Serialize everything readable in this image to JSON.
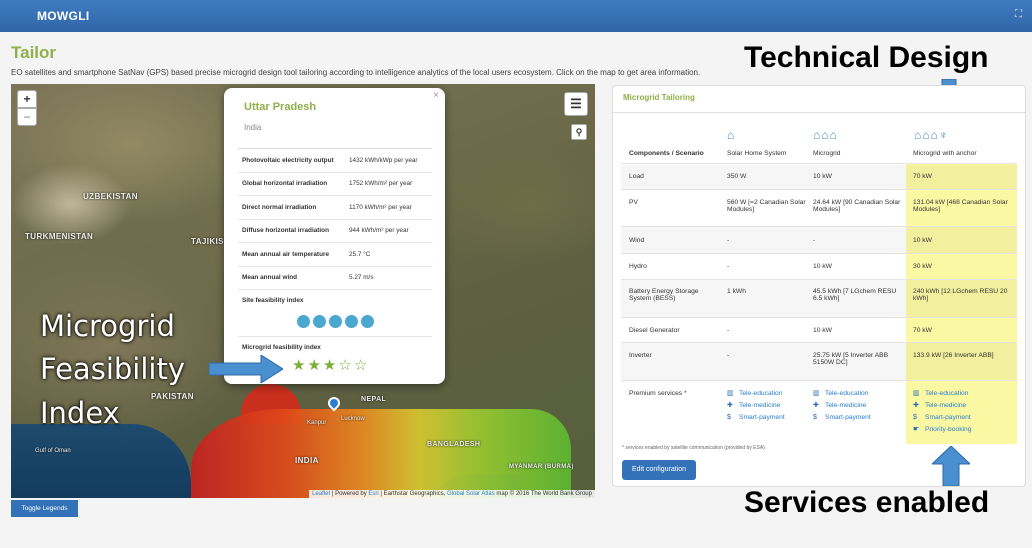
{
  "app": {
    "brand": "MOWGLI",
    "expand_icon": "expand-icon"
  },
  "page": {
    "title": "Tailor",
    "description": "EO satellites and smartphone SatNav (GPS) based precise microgrid design tool tailoring according to intelligence analytics of the local users ecosystem. Click on the map to get area information."
  },
  "map": {
    "zoom_in": "+",
    "zoom_out": "−",
    "labels": {
      "uzbekistan": "UZBEKISTAN",
      "turkmenistan": "TURKMENISTAN",
      "tajikistan": "TAJIKIST",
      "pakistan": "PAKISTAN",
      "nepal": "NEPAL",
      "india": "INDIA",
      "bangladesh": "BANGLADESH",
      "myanmar": "MYANMAR (BURMA)",
      "kanpur": "Kanpur",
      "lucknow": "Lucknow",
      "gulf": "Gulf of Oman"
    },
    "attribution": {
      "leaflet": "Leaflet",
      "powered": " | Powered by ",
      "esri": "Esri",
      "rest": " | Earthstar Geographics, ",
      "gsa": "Global Solar Atlas",
      "tail": " map © 2016 The World Bank Group"
    }
  },
  "popup": {
    "region": "Uttar Pradesh",
    "country": "India",
    "close": "×",
    "stats": [
      {
        "label": "Photovoltaic electricity output",
        "value": "1432 kWh/kWp per year"
      },
      {
        "label": "Global horizontal irradiation",
        "value": "1752 kWh/m² per year"
      },
      {
        "label": "Direct normal irradiation",
        "value": "1170 kWh/m² per year"
      },
      {
        "label": "Diffuse horizontal irradiation",
        "value": "944 kWh/m² per year"
      },
      {
        "label": "Mean annual air temperature",
        "value": "25.7 °C"
      },
      {
        "label": "Mean annual wind",
        "value": "5.27 m/s"
      }
    ],
    "site_feasibility_title": "Site feasibility index",
    "site_feasibility_dots": 5,
    "microgrid_feasibility_title": "Microgrid feasibility index",
    "microgrid_feasibility_rating": 3,
    "microgrid_feasibility_max": 5,
    "star_filled": "★",
    "star_empty": "☆"
  },
  "callouts": {
    "feasibility_line1": "Microgrid",
    "feasibility_line2": "Feasibility",
    "feasibility_line3": "Index",
    "technical_design": "Technical Design",
    "services_enabled": "Services enabled"
  },
  "panel": {
    "title": "Microgrid Tailoring",
    "header": {
      "components_label": "Components / Scenario",
      "col1": "Solar Home System",
      "col2": "Microgrid",
      "col3": "Microgrid with anchor"
    },
    "rows": [
      {
        "label": "Load",
        "c1": "350 W",
        "c2": "10 kW",
        "c3": "70 kW"
      },
      {
        "label": "PV",
        "c1": "560 W [=2 Canadian Solar Modules]",
        "c2": "24.64 kW [90 Canadian Solar Modules]",
        "c3": "131.04 kW [468 Canadian Solar Modules]"
      },
      {
        "label": "Wind",
        "c1": "-",
        "c2": "-",
        "c3": "10 kW"
      },
      {
        "label": "Hydro",
        "c1": "-",
        "c2": "10 kW",
        "c3": "30 kW"
      },
      {
        "label": "Battery Energy Storage System (BESS)",
        "c1": "1 kWh",
        "c2": "45.5 kWh [7 LGchem RESU 6.5 kWh]",
        "c3": "240 kWh [12 LGchem RESU 20 kWh]"
      },
      {
        "label": "Diesel Generator",
        "c1": "-",
        "c2": "10 kW",
        "c3": "70 kW"
      },
      {
        "label": "Inverter",
        "c1": "-",
        "c2": "25.75 kW [5 Inverter ABB 5150W DC]",
        "c3": "133.9 kW [26 Inverter ABB]"
      }
    ],
    "premium_label": "Premium services *",
    "services_col1": [
      "Tele-education",
      "Tele-medicine",
      "Smart-payment"
    ],
    "services_col2": [
      "Tele-education",
      "Tele-medicine",
      "Smart-payment"
    ],
    "services_col3": [
      "Tele-education",
      "Tele-medicine",
      "Smart-payment",
      "Priority-booking"
    ],
    "footnote": "* services enabled by satellite communication (provided by ESA)",
    "edit_button": "Edit configuration"
  },
  "toggle_legends": "Toggle Legends",
  "colors": {
    "accent_green": "#8fb04a",
    "primary_blue": "#3372b8",
    "highlight_yellow": "#fbf8a4",
    "arrow_blue": "#4a8fd0"
  }
}
